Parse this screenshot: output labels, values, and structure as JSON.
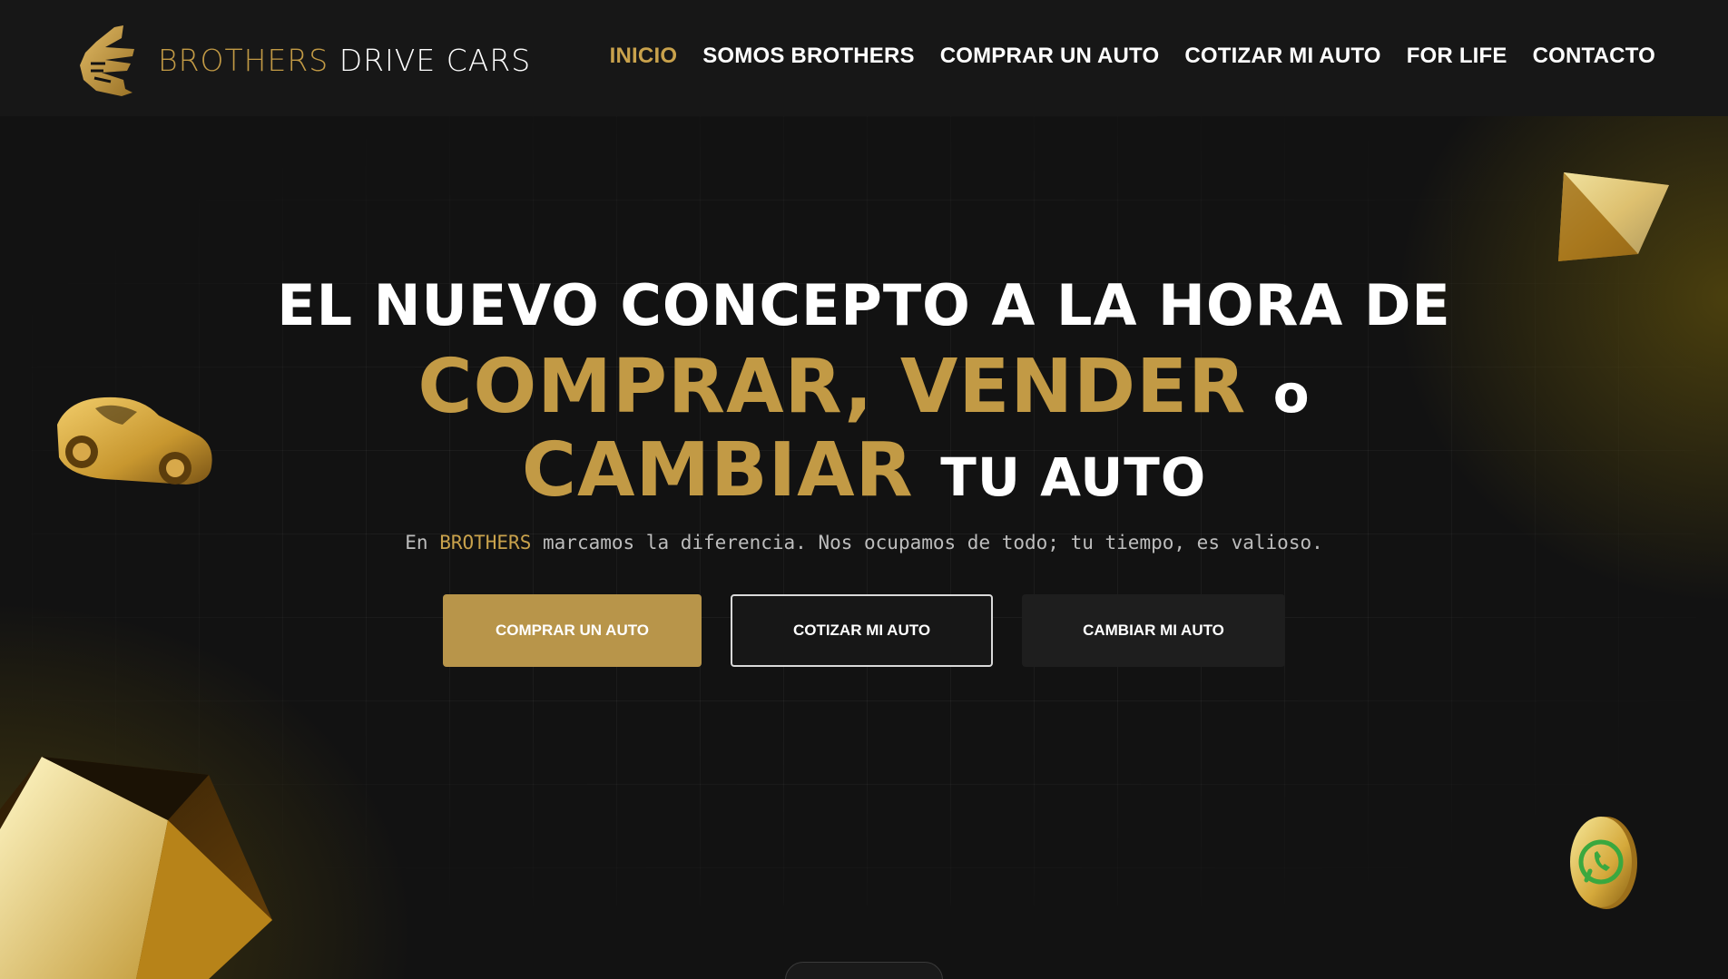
{
  "header": {
    "logo": {
      "brand_gold": "BROTHERS",
      "brand_white": "DRIVE CARS",
      "icon": "shaka-hand-icon"
    },
    "nav": [
      {
        "label": "INICIO",
        "active": true
      },
      {
        "label": "SOMOS BROTHERS",
        "active": false
      },
      {
        "label": "COMPRAR UN AUTO",
        "active": false
      },
      {
        "label": "COTIZAR MI AUTO",
        "active": false
      },
      {
        "label": "FOR LIFE",
        "active": false
      },
      {
        "label": "CONTACTO",
        "active": false
      }
    ]
  },
  "hero": {
    "line1": "EL NUEVO CONCEPTO A LA HORA DE",
    "line2_gold": "COMPRAR, VENDER",
    "line2_white": "o",
    "line3_gold": "CAMBIAR",
    "line3_white": "TU AUTO",
    "sub_prefix": "En",
    "sub_brand": "BROTHERS",
    "sub_rest": "marcamos la diferencia. Nos ocupamos de todo; tu tiempo, es valioso.",
    "buttons": {
      "buy": "COMPRAR UN AUTO",
      "quote": "COTIZAR MI AUTO",
      "change": "CAMBIAR MI AUTO"
    }
  },
  "floating": {
    "whatsapp_icon": "whatsapp-icon"
  },
  "colors": {
    "gold": "#c29a45",
    "background": "#121212",
    "header": "#171717"
  }
}
